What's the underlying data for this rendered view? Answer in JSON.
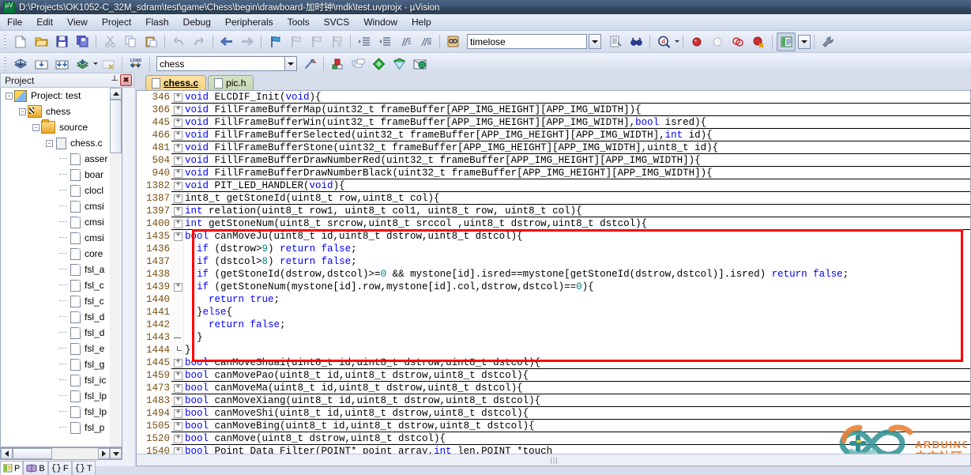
{
  "window": {
    "title": "D:\\Projects\\OK1052-C_32M_sdram\\test\\game\\Chess\\begin\\drawboard-加时钟\\mdk\\test.uvprojx - µVision",
    "app_logo": "uvision-logo-icon"
  },
  "menu": {
    "items": [
      "File",
      "Edit",
      "View",
      "Project",
      "Flash",
      "Debug",
      "Peripherals",
      "Tools",
      "SVCS",
      "Window",
      "Help"
    ]
  },
  "toolbar_main": {
    "buttons": [
      {
        "name": "new-file-button",
        "icon": "new-document-icon"
      },
      {
        "name": "open-file-button",
        "icon": "open-folder-icon"
      },
      {
        "name": "save-button",
        "icon": "floppy-save-icon"
      },
      {
        "name": "save-all-button",
        "icon": "save-all-icon"
      },
      {
        "name": "cut-button",
        "icon": "scissors-icon"
      },
      {
        "name": "copy-button",
        "icon": "copy-icon"
      },
      {
        "name": "paste-button",
        "icon": "clipboard-paste-icon"
      },
      {
        "name": "undo-button",
        "icon": "undo-arrow-icon"
      },
      {
        "name": "redo-button",
        "icon": "redo-arrow-icon"
      },
      {
        "name": "navigate-back-button",
        "icon": "arrow-left-icon"
      },
      {
        "name": "navigate-forward-button",
        "icon": "arrow-right-icon"
      },
      {
        "name": "toggle-bookmark-button",
        "icon": "bookmark-flag-icon"
      },
      {
        "name": "prev-bookmark-button",
        "icon": "bookmark-prev-icon"
      },
      {
        "name": "next-bookmark-button",
        "icon": "bookmark-next-icon"
      },
      {
        "name": "clear-bookmarks-button",
        "icon": "bookmark-clear-icon"
      },
      {
        "name": "indent-button",
        "icon": "indent-right-icon"
      },
      {
        "name": "outdent-button",
        "icon": "indent-left-icon"
      },
      {
        "name": "comment-button",
        "icon": "comment-lines-icon"
      },
      {
        "name": "uncomment-button",
        "icon": "uncomment-lines-icon"
      },
      {
        "name": "find-in-files-button",
        "icon": "binoculars-book-icon"
      }
    ],
    "find_box": {
      "name": "find-combo",
      "value": "timelose",
      "placeholder": ""
    },
    "right_buttons": [
      {
        "name": "insert-file-button",
        "icon": "document-arrow-icon"
      },
      {
        "name": "find-next-button",
        "icon": "binoculars-icon"
      },
      {
        "name": "debug-search-button",
        "icon": "magnifier-d-icon"
      },
      {
        "name": "insert-breakpoint-button",
        "icon": "red-dot-icon"
      },
      {
        "name": "disable-breakpoint-button",
        "icon": "white-dot-icon"
      },
      {
        "name": "disable-all-breakpoints-button",
        "icon": "two-circles-icon"
      },
      {
        "name": "kill-all-breakpoints-button",
        "icon": "red-dot-x-icon"
      },
      {
        "name": "manage-windows-button",
        "icon": "window-layout-icon"
      },
      {
        "name": "configuration-wizard-button",
        "icon": "wrench-icon"
      }
    ]
  },
  "toolbar_build": {
    "buttons": [
      {
        "name": "translate-button",
        "icon": "translate-layers-icon"
      },
      {
        "name": "build-button",
        "icon": "build-target-icon"
      },
      {
        "name": "rebuild-button",
        "icon": "rebuild-all-icon"
      },
      {
        "name": "batch-build-button",
        "icon": "batch-build-icon"
      },
      {
        "name": "stop-build-button",
        "icon": "stop-build-icon"
      },
      {
        "name": "download-button",
        "icon": "load-download-icon"
      }
    ],
    "target_combo": {
      "name": "target-combo",
      "value": "chess"
    },
    "right_buttons": [
      {
        "name": "start-stop-debug-button",
        "icon": "debug-wand-icon"
      },
      {
        "name": "target-options-button",
        "icon": "target-options-icon"
      },
      {
        "name": "manage-project-items-button",
        "icon": "manage-items-icon"
      },
      {
        "name": "pack-installer-button",
        "icon": "green-diamond-icon"
      },
      {
        "name": "manage-runtime-button",
        "icon": "green-cone-icon"
      },
      {
        "name": "select-software-packs-button",
        "icon": "globe-pack-icon"
      }
    ]
  },
  "project_panel": {
    "title": "Project",
    "pin_icon": "pin-icon",
    "close_icon": "close-icon",
    "tree": [
      {
        "label": "Project: test",
        "icon": "project-icon",
        "depth": 0,
        "expander": "-"
      },
      {
        "label": "chess",
        "icon": "chess-target-icon",
        "depth": 1,
        "expander": "-"
      },
      {
        "label": "source",
        "icon": "folder-icon",
        "depth": 2,
        "expander": "-"
      },
      {
        "label": "chess.c",
        "icon": "source-file-icon",
        "depth": 3,
        "expander": "-"
      },
      {
        "label": "asser",
        "icon": "file-icon",
        "depth": 4,
        "expander": ""
      },
      {
        "label": "boar",
        "icon": "file-icon",
        "depth": 4,
        "expander": ""
      },
      {
        "label": "clocl",
        "icon": "file-icon",
        "depth": 4,
        "expander": ""
      },
      {
        "label": "cmsi",
        "icon": "file-icon",
        "depth": 4,
        "expander": ""
      },
      {
        "label": "cmsi",
        "icon": "file-icon",
        "depth": 4,
        "expander": ""
      },
      {
        "label": "cmsi",
        "icon": "file-icon",
        "depth": 4,
        "expander": ""
      },
      {
        "label": "core",
        "icon": "file-icon",
        "depth": 4,
        "expander": ""
      },
      {
        "label": "fsl_a",
        "icon": "file-icon",
        "depth": 4,
        "expander": ""
      },
      {
        "label": "fsl_c",
        "icon": "file-icon",
        "depth": 4,
        "expander": ""
      },
      {
        "label": "fsl_c",
        "icon": "file-icon",
        "depth": 4,
        "expander": ""
      },
      {
        "label": "fsl_d",
        "icon": "file-icon",
        "depth": 4,
        "expander": ""
      },
      {
        "label": "fsl_d",
        "icon": "file-icon",
        "depth": 4,
        "expander": ""
      },
      {
        "label": "fsl_e",
        "icon": "file-icon",
        "depth": 4,
        "expander": ""
      },
      {
        "label": "fsl_g",
        "icon": "file-icon",
        "depth": 4,
        "expander": ""
      },
      {
        "label": "fsl_ic",
        "icon": "file-icon",
        "depth": 4,
        "expander": ""
      },
      {
        "label": "fsl_lp",
        "icon": "file-icon",
        "depth": 4,
        "expander": ""
      },
      {
        "label": "fsl_lp",
        "icon": "file-icon",
        "depth": 4,
        "expander": ""
      },
      {
        "label": "fsl_p",
        "icon": "file-icon",
        "depth": 4,
        "expander": ""
      }
    ],
    "bottom_tabs": [
      {
        "label": "P",
        "icon": "project-tab-icon",
        "active": true
      },
      {
        "label": "B",
        "icon": "books-tab-icon",
        "active": false
      },
      {
        "label": "F",
        "icon": "functions-tab-icon",
        "active": false
      },
      {
        "label": "T",
        "icon": "templates-tab-icon",
        "active": false
      }
    ]
  },
  "editor": {
    "tabs": [
      {
        "label": "chess.c",
        "active": true
      },
      {
        "label": "pic.h",
        "active": false
      }
    ],
    "lines": [
      {
        "n": "346",
        "fold": "+",
        "rule": true,
        "code": [
          {
            "t": "void ",
            "c": "kw"
          },
          {
            "t": "ELCDIF_Init(",
            "c": ""
          },
          {
            "t": "void",
            "c": "kw"
          },
          {
            "t": "){",
            "c": ""
          }
        ]
      },
      {
        "n": "366",
        "fold": "+",
        "rule": true,
        "code": [
          {
            "t": "void ",
            "c": "kw"
          },
          {
            "t": "FillFrameBufferMap(uint32_t frameBuffer[APP_IMG_HEIGHT][APP_IMG_WIDTH]){",
            "c": ""
          }
        ]
      },
      {
        "n": "445",
        "fold": "+",
        "rule": true,
        "code": [
          {
            "t": "void ",
            "c": "kw"
          },
          {
            "t": "FillFrameBufferWin(uint32_t frameBuffer[APP_IMG_HEIGHT][APP_IMG_WIDTH],",
            "c": ""
          },
          {
            "t": "bool",
            "c": "kw"
          },
          {
            "t": " isred){",
            "c": ""
          }
        ]
      },
      {
        "n": "466",
        "fold": "+",
        "rule": true,
        "code": [
          {
            "t": "void ",
            "c": "kw"
          },
          {
            "t": "FillFrameBufferSelected(uint32_t frameBuffer[APP_IMG_HEIGHT][APP_IMG_WIDTH],",
            "c": ""
          },
          {
            "t": "int",
            "c": "kw"
          },
          {
            "t": " id){",
            "c": ""
          }
        ]
      },
      {
        "n": "481",
        "fold": "+",
        "rule": true,
        "code": [
          {
            "t": "void ",
            "c": "kw"
          },
          {
            "t": "FillFrameBufferStone(uint32_t frameBuffer[APP_IMG_HEIGHT][APP_IMG_WIDTH],uint8_t id){",
            "c": ""
          }
        ]
      },
      {
        "n": "504",
        "fold": "+",
        "rule": true,
        "code": [
          {
            "t": "void ",
            "c": "kw"
          },
          {
            "t": "FillFrameBufferDrawNumberRed(uint32_t frameBuffer[APP_IMG_HEIGHT][APP_IMG_WIDTH]){",
            "c": ""
          }
        ]
      },
      {
        "n": "940",
        "fold": "+",
        "rule": true,
        "code": [
          {
            "t": "void ",
            "c": "kw"
          },
          {
            "t": "FillFrameBufferDrawNumberBlack(uint32_t frameBuffer[APP_IMG_HEIGHT][APP_IMG_WIDTH]){",
            "c": ""
          }
        ]
      },
      {
        "n": "1382",
        "fold": "+",
        "rule": true,
        "code": [
          {
            "t": "void ",
            "c": "kw"
          },
          {
            "t": "PIT_LED_HANDLER(",
            "c": ""
          },
          {
            "t": "void",
            "c": "kw"
          },
          {
            "t": "){",
            "c": ""
          }
        ]
      },
      {
        "n": "1387",
        "fold": "+",
        "rule": true,
        "code": [
          {
            "t": "int8_t getStoneId(uint8_t row,uint8_t col){",
            "c": ""
          }
        ]
      },
      {
        "n": "1397",
        "fold": "+",
        "rule": true,
        "code": [
          {
            "t": "int ",
            "c": "kw"
          },
          {
            "t": "relation(uint8_t row1, uint8_t col1, uint8_t row, uint8_t col){",
            "c": ""
          }
        ]
      },
      {
        "n": "1400",
        "fold": "+",
        "rule": true,
        "code": [
          {
            "t": "int ",
            "c": "kw"
          },
          {
            "t": "getStoneNum(uint8_t srcrow,uint8_t srccol ,uint8_t dstrow,uint8_t dstcol){",
            "c": ""
          }
        ]
      },
      {
        "n": "1435",
        "fold": "+",
        "rule": false,
        "code": [
          {
            "t": "bool ",
            "c": "kw"
          },
          {
            "t": "canMoveJu(uint8_t id,uint8_t dstrow,uint8_t dstcol){",
            "c": ""
          }
        ]
      },
      {
        "n": "1436",
        "fold": "",
        "rule": false,
        "code": [
          {
            "t": "  if ",
            "c": "kw"
          },
          {
            "t": "(dstrow>",
            "c": ""
          },
          {
            "t": "9",
            "c": "num"
          },
          {
            "t": ") ",
            "c": ""
          },
          {
            "t": "return false",
            "c": "kw"
          },
          {
            "t": ";",
            "c": ""
          }
        ]
      },
      {
        "n": "1437",
        "fold": "",
        "rule": false,
        "code": [
          {
            "t": "  if ",
            "c": "kw"
          },
          {
            "t": "(dstcol>",
            "c": ""
          },
          {
            "t": "8",
            "c": "num"
          },
          {
            "t": ") ",
            "c": ""
          },
          {
            "t": "return false",
            "c": "kw"
          },
          {
            "t": ";",
            "c": ""
          }
        ]
      },
      {
        "n": "1438",
        "fold": "",
        "rule": false,
        "code": [
          {
            "t": "  if ",
            "c": "kw"
          },
          {
            "t": "(getStoneId(dstrow,dstcol)>=",
            "c": ""
          },
          {
            "t": "0",
            "c": "num"
          },
          {
            "t": " && mystone[id].isred==mystone[getStoneId(dstrow,dstcol)].isred) ",
            "c": ""
          },
          {
            "t": "return false",
            "c": "kw"
          },
          {
            "t": ";",
            "c": ""
          }
        ]
      },
      {
        "n": "1439",
        "fold": "+",
        "rule": false,
        "code": [
          {
            "t": "  if ",
            "c": "kw"
          },
          {
            "t": "(getStoneNum(mystone[id].row,mystone[id].col,dstrow,dstcol)==",
            "c": ""
          },
          {
            "t": "0",
            "c": "num"
          },
          {
            "t": "){",
            "c": ""
          }
        ]
      },
      {
        "n": "1440",
        "fold": "",
        "rule": false,
        "code": [
          {
            "t": "    ",
            "c": ""
          },
          {
            "t": "return true",
            "c": "kw"
          },
          {
            "t": ";",
            "c": ""
          }
        ]
      },
      {
        "n": "1441",
        "fold": "",
        "rule": false,
        "code": [
          {
            "t": "  }",
            "c": ""
          },
          {
            "t": "else",
            "c": "kw"
          },
          {
            "t": "{",
            "c": ""
          }
        ]
      },
      {
        "n": "1442",
        "fold": "",
        "rule": false,
        "code": [
          {
            "t": "    ",
            "c": ""
          },
          {
            "t": "return false",
            "c": "kw"
          },
          {
            "t": ";",
            "c": ""
          }
        ]
      },
      {
        "n": "1443",
        "fold": "-",
        "rule": false,
        "code": [
          {
            "t": "  }",
            "c": ""
          }
        ]
      },
      {
        "n": "1444",
        "fold": "L",
        "rule": false,
        "code": [
          {
            "t": "}",
            "c": ""
          }
        ]
      },
      {
        "n": "1445",
        "fold": "+",
        "rule": true,
        "code": [
          {
            "t": "bool ",
            "c": "kw"
          },
          {
            "t": "canMoveShuai(uint8_t id,uint8_t dstrow,uint8_t dstcol){",
            "c": ""
          }
        ]
      },
      {
        "n": "1459",
        "fold": "+",
        "rule": true,
        "code": [
          {
            "t": "bool ",
            "c": "kw"
          },
          {
            "t": "canMovePao(uint8_t id,uint8_t dstrow,uint8_t dstcol){",
            "c": ""
          }
        ]
      },
      {
        "n": "1473",
        "fold": "+",
        "rule": true,
        "code": [
          {
            "t": "bool ",
            "c": "kw"
          },
          {
            "t": "canMoveMa(uint8_t id,uint8_t dstrow,uint8_t dstcol){",
            "c": ""
          }
        ]
      },
      {
        "n": "1483",
        "fold": "+",
        "rule": true,
        "code": [
          {
            "t": "bool ",
            "c": "kw"
          },
          {
            "t": "canMoveXiang(uint8_t id,uint8_t dstrow,uint8_t dstcol){",
            "c": ""
          }
        ]
      },
      {
        "n": "1494",
        "fold": "+",
        "rule": true,
        "code": [
          {
            "t": "bool ",
            "c": "kw"
          },
          {
            "t": "canMoveShi(uint8_t id,uint8_t dstrow,uint8_t dstcol){",
            "c": ""
          }
        ]
      },
      {
        "n": "1505",
        "fold": "+",
        "rule": true,
        "code": [
          {
            "t": "bool ",
            "c": "kw"
          },
          {
            "t": "canMoveBing(uint8_t id,uint8_t dstrow,uint8_t dstcol){",
            "c": ""
          }
        ]
      },
      {
        "n": "1520",
        "fold": "+",
        "rule": true,
        "code": [
          {
            "t": "bool ",
            "c": "kw"
          },
          {
            "t": "canMove(uint8_t dstrow,uint8_t dstcol){",
            "c": ""
          }
        ]
      },
      {
        "n": "1540",
        "fold": "+",
        "rule": true,
        "code": [
          {
            "t": "bool ",
            "c": "kw"
          },
          {
            "t": "Point_Data_Filter(POINT* point_array,",
            "c": ""
          },
          {
            "t": "int ",
            "c": "kw"
          },
          {
            "t": "len,POINT *touch",
            "c": ""
          }
        ]
      }
    ],
    "annotation": {
      "name": "red-highlight-box",
      "color": "#ff0000"
    }
  },
  "watermark": {
    "brand": "ARDUINO",
    "subtitle": "中文社区",
    "color": "#2e8f92",
    "accent": "#e8833a"
  }
}
